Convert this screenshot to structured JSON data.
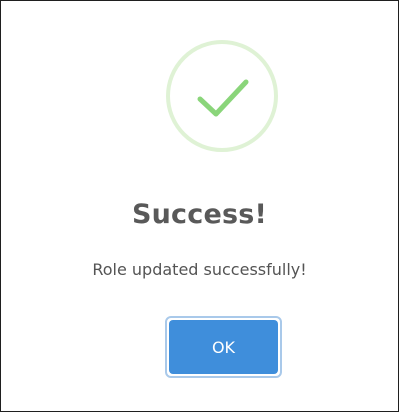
{
  "dialog": {
    "icon": "success-check-icon",
    "title": "Success!",
    "message": "Role updated successfully!",
    "ok_label": "OK"
  },
  "colors": {
    "success_ring": "#dff2d5",
    "success_check": "#8ad57a",
    "button_bg": "#3f8edb",
    "button_focus_ring": "#a9c9ea",
    "title_text": "#595959",
    "message_text": "#545454"
  }
}
